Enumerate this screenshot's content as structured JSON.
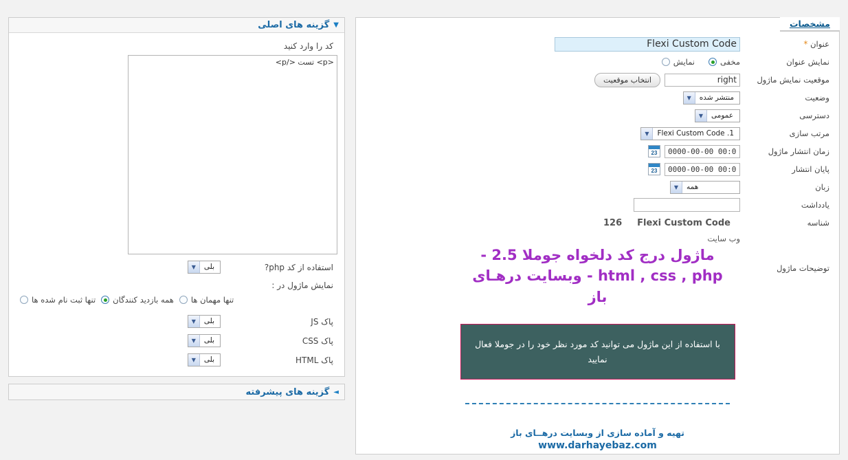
{
  "details": {
    "tab_label": "مشخصات",
    "fields": {
      "title": {
        "label": "عنوان",
        "required_mark": "*",
        "value": "Flexi Custom Code"
      },
      "show_title": {
        "label": "نمایش عنوان",
        "options": [
          {
            "label": "نمایش",
            "selected": false
          },
          {
            "label": "مخفی",
            "selected": true
          }
        ]
      },
      "position": {
        "label": "موقعیت نمایش ماژول",
        "value": "right",
        "button": "انتخاب موقعیت"
      },
      "status": {
        "label": "وضعیت",
        "value": "منتشر شده"
      },
      "access": {
        "label": "دسترسی",
        "value": "عمومی"
      },
      "ordering": {
        "label": "مرتب سازی",
        "value": "1. Flexi Custom Code"
      },
      "start_publishing": {
        "label": "زمان انتشار ماژول",
        "value": "0000-00-00 00:00:00",
        "calendar_day": "23"
      },
      "finish_publishing": {
        "label": "پایان انتشار",
        "value": "0000-00-00 00:00:00",
        "calendar_day": "23"
      },
      "language": {
        "label": "زبان",
        "value": "همه"
      },
      "note": {
        "label": "یادداشت",
        "value": ""
      },
      "id": {
        "label": "شناسه",
        "number": "126",
        "module_name": "Flexi Custom Code"
      },
      "website": {
        "text": "وب سایت"
      },
      "module_description": {
        "label": "توضیحات ماژول"
      }
    }
  },
  "promo": {
    "title": "ماژول درج کد دلخواه جوملا 2.5 - html , css , php - وبسایت درهـای باز",
    "box_text": "با استفاده از این ماژول می توانید کد مورد نظر خود را در جوملا فعال نمایید",
    "credit": "تهیه و آماده سازی از وبسایت درهــای باز",
    "url": "www.darhayebaz.com"
  },
  "basic_options": {
    "title": "گزینه های اصلی",
    "arrow": "▼",
    "code_label": "کد را وارد کنید",
    "code_value": "<p> تست </p>",
    "use_php": {
      "label": "استفاده از کد php?",
      "value": "بلی"
    },
    "show_module_in": {
      "label": "نمایش ماژول در :",
      "options": [
        {
          "label": "تنها ثبت نام شده ها",
          "selected": false
        },
        {
          "label": "همه بازدید کنندگان",
          "selected": true
        },
        {
          "label": "تنها مهمان ها",
          "selected": false
        }
      ]
    },
    "clean_js": {
      "label": "پاک JS",
      "value": "بلی"
    },
    "clean_css": {
      "label": "پاک CSS",
      "value": "بلی"
    },
    "clean_html": {
      "label": "پاک HTML",
      "value": "بلی"
    }
  },
  "advanced_options": {
    "title": "گزینه های پیشرفته",
    "arrow": "◄"
  },
  "icons": {
    "chevron_down": "▼",
    "calendar": "calendar-icon"
  },
  "colors": {
    "promo_purple": "#a12ec4",
    "box_bg": "#3d6160",
    "box_border": "#c9175a",
    "link_blue": "#1b6aa5",
    "title_field_bg": "#ddf0fb"
  }
}
